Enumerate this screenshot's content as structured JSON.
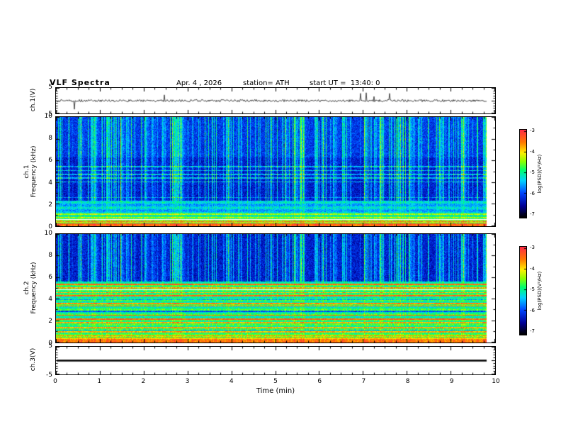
{
  "header": {
    "title": "VLF Spectra",
    "date": "Apr. 4 , 2026",
    "station": "station= ATH",
    "start_ut": "start UT =  13:40: 0"
  },
  "x_axis": {
    "label": "Time (min)",
    "ticks": [
      "0",
      "1",
      "2",
      "3",
      "4",
      "5",
      "6",
      "7",
      "8",
      "9",
      "10"
    ],
    "data_end_min": 9.8
  },
  "colorbar": {
    "label": "log(PSD)(V²/Hz)",
    "ticks": [
      "-3",
      "-4",
      "-5",
      "-6",
      "-7"
    ],
    "min": -7,
    "max": -3
  },
  "panels": {
    "ch1_wave": {
      "ylabel": "ch.1(V)",
      "yticks": [
        "5",
        "-5"
      ],
      "ylim": [
        -5,
        5
      ]
    },
    "ch1_spec": {
      "ylabel_line1": "ch.1",
      "ylabel_line2": "Frequency (kHz)",
      "yticks": [
        "10",
        "8",
        "6",
        "4",
        "2",
        "0"
      ],
      "ylim": [
        0,
        10
      ]
    },
    "ch2_spec": {
      "ylabel_line1": "ch.2",
      "ylabel_line2": "Frequency (kHz)",
      "yticks": [
        "10",
        "8",
        "6",
        "4",
        "2",
        "0"
      ],
      "ylim": [
        0,
        10
      ]
    },
    "ch3_wave": {
      "ylabel": "ch.3(V)",
      "yticks": [
        "5",
        "-5"
      ],
      "ylim": [
        -5,
        5
      ]
    }
  },
  "chart_data": [
    {
      "type": "line",
      "name": "ch.1 voltage waveform",
      "xlabel": "Time (min)",
      "xlim": [
        0,
        10
      ],
      "ylabel": "ch.1(V)",
      "ylim": [
        -5,
        5
      ],
      "description": "Noisy trace centered on 0 V with frequent short impulsive spikes (sferics) reaching roughly +/-2 to +/-4 V throughout; record ends near 9.8 min"
    },
    {
      "type": "heatmap",
      "name": "ch.1 VLF spectrogram",
      "xlabel": "Time (min)",
      "xlim": [
        0,
        10
      ],
      "ylabel": "Frequency (kHz)",
      "ylim": [
        0,
        10
      ],
      "zlabel": "log(PSD)(V²/Hz)",
      "zlim": [
        -7,
        -3
      ],
      "palette": "black-blue-cyan-green-yellow-red",
      "features": {
        "background_level": -6.5,
        "broadband_vertical_streaks": "dense impulsive sferic streaks spanning ~1-10 kHz at level about -5 (green), occurring throughout the record",
        "strong_bands_below_kHz": 1.2,
        "low_freq_band_level": -3.5,
        "narrowband_enhanced_lines_kHz": [
          4.1,
          4.4,
          4.8,
          5.1,
          5.4
        ],
        "data_end_min": 9.8
      }
    },
    {
      "type": "heatmap",
      "name": "ch.2 VLF spectrogram",
      "xlabel": "Time (min)",
      "xlim": [
        0,
        10
      ],
      "ylabel": "Frequency (kHz)",
      "ylim": [
        0,
        10
      ],
      "zlabel": "log(PSD)(V²/Hz)",
      "zlim": [
        -7,
        -3
      ],
      "palette": "black-blue-cyan-green-yellow-red",
      "features": {
        "dark_background_above_kHz": 5.6,
        "background_level_above": -6.5,
        "elevated_region_kHz": [
          0,
          5.6
        ],
        "elevated_region_level": -5,
        "narrowband_red_lines_kHz": [
          1.0,
          1.4,
          1.8,
          2.2,
          2.5,
          3.4,
          3.6,
          4.3,
          4.6,
          5.0,
          5.4
        ],
        "strong_bands_below_kHz": 0.8,
        "broadband_vertical_streaks": "sferic streaks cross the upper dark region, aligned with ch.1",
        "data_end_min": 9.8
      }
    },
    {
      "type": "line",
      "name": "ch.3 voltage waveform",
      "xlabel": "Time (min)",
      "xlim": [
        0,
        10
      ],
      "ylabel": "ch.3(V)",
      "ylim": [
        -5,
        5
      ],
      "description": "Constant flat thick trace at 0 V for the entire record (no signal on this channel)"
    }
  ]
}
